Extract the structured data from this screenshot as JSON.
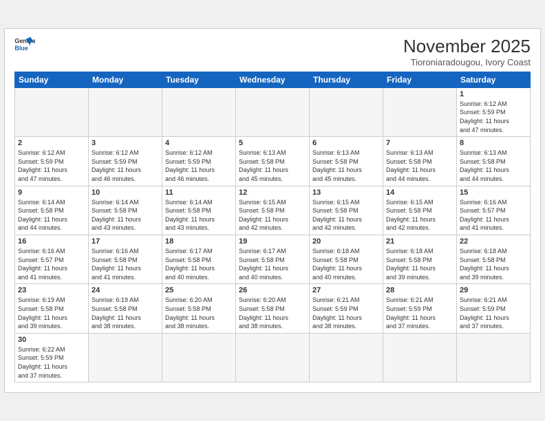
{
  "header": {
    "logo_line1": "General",
    "logo_line2": "Blue",
    "month_title": "November 2025",
    "subtitle": "Tioroniaradougou, Ivory Coast"
  },
  "weekdays": [
    "Sunday",
    "Monday",
    "Tuesday",
    "Wednesday",
    "Thursday",
    "Friday",
    "Saturday"
  ],
  "weeks": [
    [
      {
        "num": "",
        "info": ""
      },
      {
        "num": "",
        "info": ""
      },
      {
        "num": "",
        "info": ""
      },
      {
        "num": "",
        "info": ""
      },
      {
        "num": "",
        "info": ""
      },
      {
        "num": "",
        "info": ""
      },
      {
        "num": "1",
        "info": "Sunrise: 6:12 AM\nSunset: 5:59 PM\nDaylight: 11 hours\nand 47 minutes."
      }
    ],
    [
      {
        "num": "2",
        "info": "Sunrise: 6:12 AM\nSunset: 5:59 PM\nDaylight: 11 hours\nand 47 minutes."
      },
      {
        "num": "3",
        "info": "Sunrise: 6:12 AM\nSunset: 5:59 PM\nDaylight: 11 hours\nand 46 minutes."
      },
      {
        "num": "4",
        "info": "Sunrise: 6:12 AM\nSunset: 5:59 PM\nDaylight: 11 hours\nand 46 minutes."
      },
      {
        "num": "5",
        "info": "Sunrise: 6:13 AM\nSunset: 5:58 PM\nDaylight: 11 hours\nand 45 minutes."
      },
      {
        "num": "6",
        "info": "Sunrise: 6:13 AM\nSunset: 5:58 PM\nDaylight: 11 hours\nand 45 minutes."
      },
      {
        "num": "7",
        "info": "Sunrise: 6:13 AM\nSunset: 5:58 PM\nDaylight: 11 hours\nand 44 minutes."
      },
      {
        "num": "8",
        "info": "Sunrise: 6:13 AM\nSunset: 5:58 PM\nDaylight: 11 hours\nand 44 minutes."
      }
    ],
    [
      {
        "num": "9",
        "info": "Sunrise: 6:14 AM\nSunset: 5:58 PM\nDaylight: 11 hours\nand 44 minutes."
      },
      {
        "num": "10",
        "info": "Sunrise: 6:14 AM\nSunset: 5:58 PM\nDaylight: 11 hours\nand 43 minutes."
      },
      {
        "num": "11",
        "info": "Sunrise: 6:14 AM\nSunset: 5:58 PM\nDaylight: 11 hours\nand 43 minutes."
      },
      {
        "num": "12",
        "info": "Sunrise: 6:15 AM\nSunset: 5:58 PM\nDaylight: 11 hours\nand 42 minutes."
      },
      {
        "num": "13",
        "info": "Sunrise: 6:15 AM\nSunset: 5:58 PM\nDaylight: 11 hours\nand 42 minutes."
      },
      {
        "num": "14",
        "info": "Sunrise: 6:15 AM\nSunset: 5:58 PM\nDaylight: 11 hours\nand 42 minutes."
      },
      {
        "num": "15",
        "info": "Sunrise: 6:16 AM\nSunset: 5:57 PM\nDaylight: 11 hours\nand 41 minutes."
      }
    ],
    [
      {
        "num": "16",
        "info": "Sunrise: 6:16 AM\nSunset: 5:57 PM\nDaylight: 11 hours\nand 41 minutes."
      },
      {
        "num": "17",
        "info": "Sunrise: 6:16 AM\nSunset: 5:58 PM\nDaylight: 11 hours\nand 41 minutes."
      },
      {
        "num": "18",
        "info": "Sunrise: 6:17 AM\nSunset: 5:58 PM\nDaylight: 11 hours\nand 40 minutes."
      },
      {
        "num": "19",
        "info": "Sunrise: 6:17 AM\nSunset: 5:58 PM\nDaylight: 11 hours\nand 40 minutes."
      },
      {
        "num": "20",
        "info": "Sunrise: 6:18 AM\nSunset: 5:58 PM\nDaylight: 11 hours\nand 40 minutes."
      },
      {
        "num": "21",
        "info": "Sunrise: 6:18 AM\nSunset: 5:58 PM\nDaylight: 11 hours\nand 39 minutes."
      },
      {
        "num": "22",
        "info": "Sunrise: 6:18 AM\nSunset: 5:58 PM\nDaylight: 11 hours\nand 39 minutes."
      }
    ],
    [
      {
        "num": "23",
        "info": "Sunrise: 6:19 AM\nSunset: 5:58 PM\nDaylight: 11 hours\nand 39 minutes."
      },
      {
        "num": "24",
        "info": "Sunrise: 6:19 AM\nSunset: 5:58 PM\nDaylight: 11 hours\nand 38 minutes."
      },
      {
        "num": "25",
        "info": "Sunrise: 6:20 AM\nSunset: 5:58 PM\nDaylight: 11 hours\nand 38 minutes."
      },
      {
        "num": "26",
        "info": "Sunrise: 6:20 AM\nSunset: 5:58 PM\nDaylight: 11 hours\nand 38 minutes."
      },
      {
        "num": "27",
        "info": "Sunrise: 6:21 AM\nSunset: 5:59 PM\nDaylight: 11 hours\nand 38 minutes."
      },
      {
        "num": "28",
        "info": "Sunrise: 6:21 AM\nSunset: 5:59 PM\nDaylight: 11 hours\nand 37 minutes."
      },
      {
        "num": "29",
        "info": "Sunrise: 6:21 AM\nSunset: 5:59 PM\nDaylight: 11 hours\nand 37 minutes."
      }
    ],
    [
      {
        "num": "30",
        "info": "Sunrise: 6:22 AM\nSunset: 5:59 PM\nDaylight: 11 hours\nand 37 minutes."
      },
      {
        "num": "",
        "info": ""
      },
      {
        "num": "",
        "info": ""
      },
      {
        "num": "",
        "info": ""
      },
      {
        "num": "",
        "info": ""
      },
      {
        "num": "",
        "info": ""
      },
      {
        "num": "",
        "info": ""
      }
    ]
  ]
}
